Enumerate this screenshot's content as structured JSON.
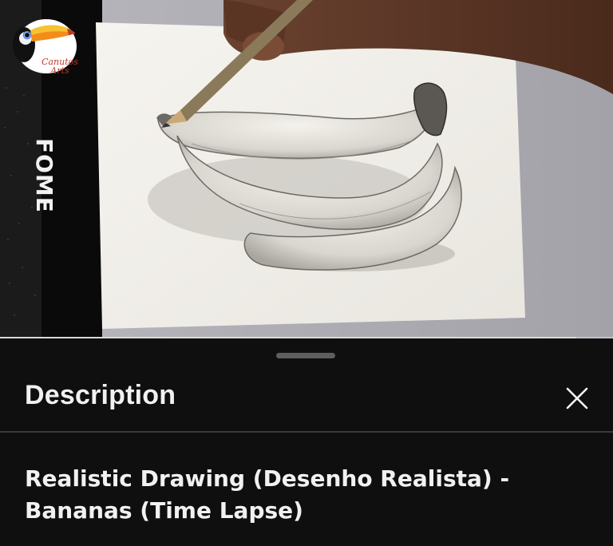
{
  "video": {
    "channel_logo_text": [
      "Canutos",
      "Arts"
    ],
    "sketchbook_brand": "FOME",
    "progress_fraction": 0.94
  },
  "description_sheet": {
    "title": "Description",
    "close_icon": "close-icon",
    "video_title": "Realistic Drawing (Desenho Realista) -  Bananas (Time Lapse)"
  },
  "colors": {
    "background": "#0f0f0f",
    "text": "#f1f1f1",
    "divider": "#3a3a3a",
    "handle": "#5e5e5e"
  }
}
